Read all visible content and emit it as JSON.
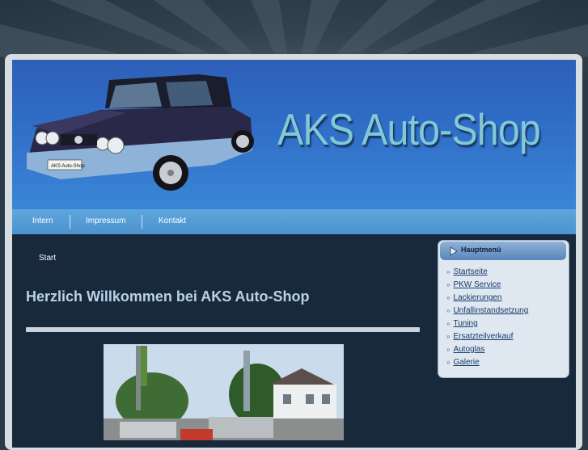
{
  "header": {
    "site_title": "AKS Auto-Shop",
    "car_plate": "AKS Auto-Shop"
  },
  "nav": {
    "items": [
      "Intern",
      "Impressum",
      "Kontakt"
    ]
  },
  "breadcrumb": "Start",
  "main": {
    "title": "Herzlich Willkommen bei AKS Auto-Shop"
  },
  "sidebar": {
    "title": "Hauptmenü",
    "items": [
      "Startseite",
      "PKW Service",
      "Lackierungen",
      "Unfallinstandsetzung",
      "Tuning",
      "Ersatzteilverkauf",
      "Autoglas",
      "Galerie"
    ]
  },
  "colors": {
    "header_blue": "#2f6cc6",
    "content_bg": "#18293b",
    "title_text": "#82c8d6",
    "link": "#173a6b"
  },
  "icons": {
    "sidebar_head": "play-arrow-icon",
    "menu_bullet": "double-chevron-right-icon"
  }
}
